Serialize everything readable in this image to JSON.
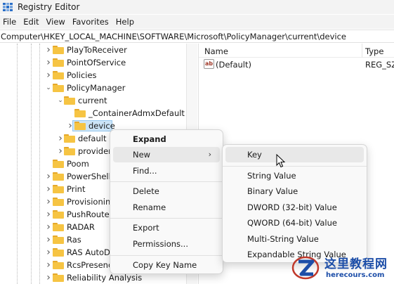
{
  "window": {
    "title": "Registry Editor"
  },
  "menu": [
    "File",
    "Edit",
    "View",
    "Favorites",
    "Help"
  ],
  "address": "Computer\\HKEY_LOCAL_MACHINE\\SOFTWARE\\Microsoft\\PolicyManager\\current\\device",
  "tree": {
    "items": [
      {
        "label": "PlayToReceiver",
        "expander": "collapsed"
      },
      {
        "label": "PointOfService",
        "expander": "collapsed"
      },
      {
        "label": "Policies",
        "expander": "collapsed"
      },
      {
        "label": "PolicyManager",
        "expander": "expanded"
      },
      {
        "label": "current",
        "expander": "expanded"
      },
      {
        "label": "_ContainerAdmxDefault",
        "expander": "none"
      },
      {
        "label": "device",
        "expander": "collapsed",
        "selected": true
      },
      {
        "label": "default",
        "expander": "collapsed"
      },
      {
        "label": "providers",
        "expander": "collapsed"
      },
      {
        "label": "Poom",
        "expander": "none"
      },
      {
        "label": "PowerShell",
        "expander": "collapsed"
      },
      {
        "label": "Print",
        "expander": "collapsed"
      },
      {
        "label": "Provisioning",
        "expander": "collapsed"
      },
      {
        "label": "PushRouter",
        "expander": "collapsed"
      },
      {
        "label": "RADAR",
        "expander": "collapsed"
      },
      {
        "label": "Ras",
        "expander": "collapsed"
      },
      {
        "label": "RAS AutoDial",
        "expander": "collapsed"
      },
      {
        "label": "RcsPresence",
        "expander": "collapsed"
      },
      {
        "label": "Reliability Analysis",
        "expander": "collapsed"
      }
    ]
  },
  "list": {
    "columns": {
      "name": "Name",
      "type": "Type"
    },
    "rows": [
      {
        "name": "(Default)",
        "type": "REG_SZ",
        "icon": "string-value-icon"
      }
    ]
  },
  "context_menu": {
    "items": [
      {
        "label": "Expand",
        "bold": true
      },
      {
        "label": "New",
        "submenu": true,
        "hover": true
      },
      {
        "label": "Find..."
      },
      {
        "separator": true
      },
      {
        "label": "Delete"
      },
      {
        "label": "Rename"
      },
      {
        "separator": true
      },
      {
        "label": "Export"
      },
      {
        "label": "Permissions..."
      },
      {
        "separator": true
      },
      {
        "label": "Copy Key Name"
      }
    ]
  },
  "submenu": {
    "items": [
      {
        "label": "Key",
        "hover": true
      },
      {
        "separator": true
      },
      {
        "label": "String Value"
      },
      {
        "label": "Binary Value"
      },
      {
        "label": "DWORD (32-bit) Value"
      },
      {
        "label": "QWORD (64-bit) Value"
      },
      {
        "label": "Multi-String Value"
      },
      {
        "label": "Expandable String Value"
      }
    ]
  },
  "watermark": {
    "title": "这里教程网",
    "url": "herecours.com"
  },
  "colors": {
    "selection": "#cce4f7",
    "folder": "#f6c443",
    "watermark": "#1d4ea8"
  }
}
